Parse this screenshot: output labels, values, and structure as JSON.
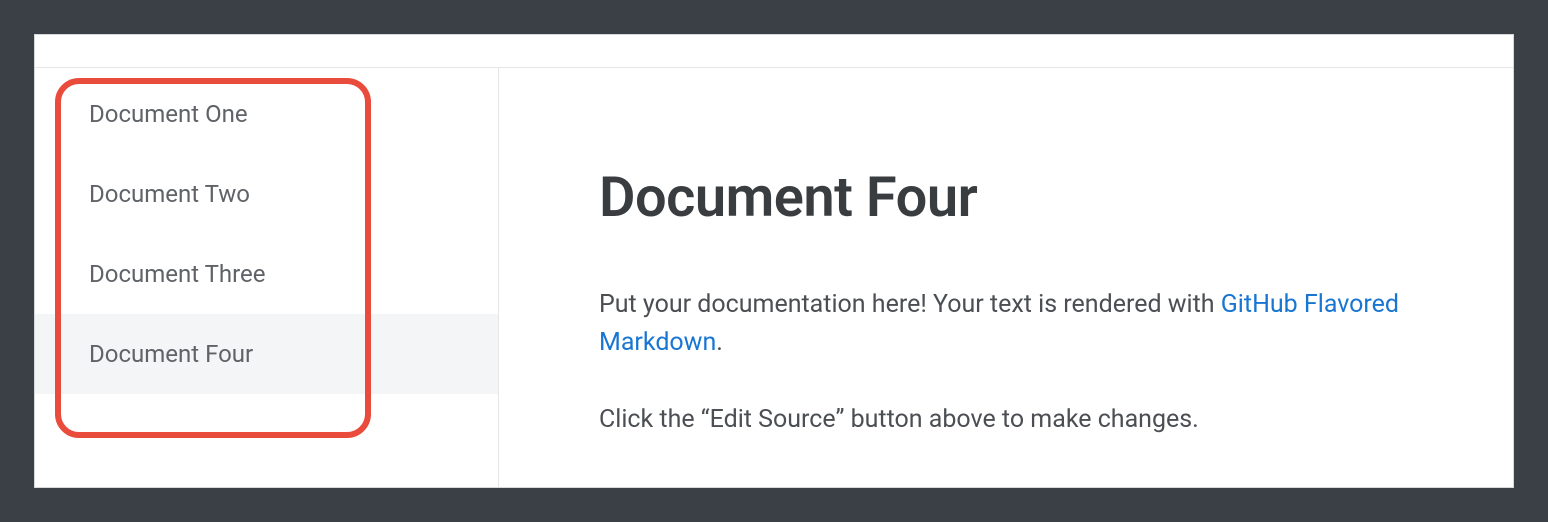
{
  "sidebar": {
    "items": [
      {
        "label": "Document One",
        "selected": false
      },
      {
        "label": "Document Two",
        "selected": false
      },
      {
        "label": "Document Three",
        "selected": false
      },
      {
        "label": "Document Four",
        "selected": true
      }
    ]
  },
  "content": {
    "title": "Document Four",
    "intro_prefix": "Put your documentation here! Your text is rendered with ",
    "link_text": "GitHub Flavored Markdown",
    "intro_suffix": ".",
    "instruction": "Click the “Edit Source” button above to make changes."
  }
}
